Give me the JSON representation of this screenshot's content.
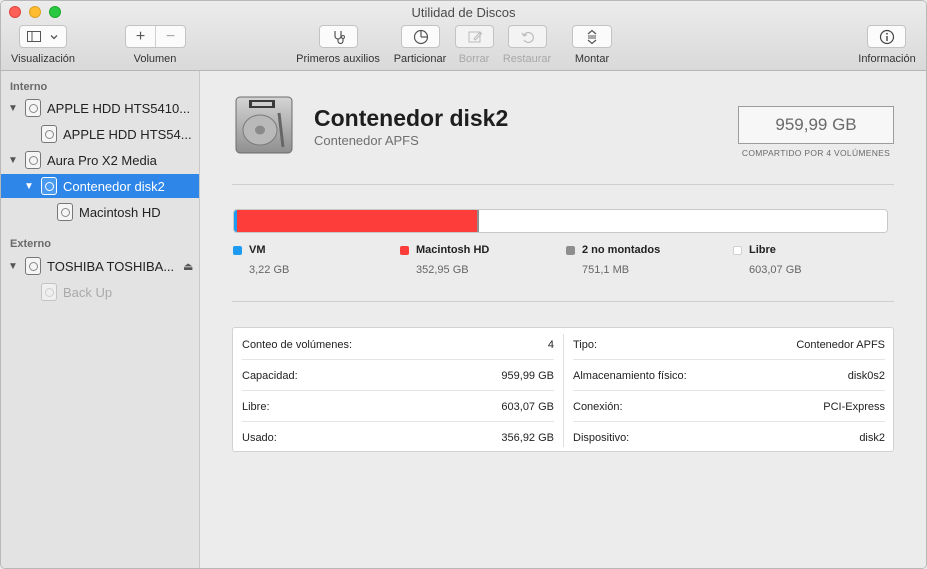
{
  "window": {
    "title": "Utilidad de Discos"
  },
  "toolbar": {
    "view_label": "Visualización",
    "volume_label": "Volumen",
    "first_aid_label": "Primeros auxilios",
    "partition_label": "Particionar",
    "erase_label": "Borrar",
    "restore_label": "Restaurar",
    "mount_label": "Montar",
    "info_label": "Información",
    "add_glyph": "+",
    "remove_glyph": "−"
  },
  "sidebar": {
    "internal_header": "Interno",
    "external_header": "Externo",
    "items": [
      {
        "label": "APPLE HDD HTS5410...",
        "level": 0
      },
      {
        "label": "APPLE HDD HTS54...",
        "level": 1
      },
      {
        "label": "Aura Pro X2 Media",
        "level": 0
      },
      {
        "label": "Contenedor disk2",
        "level": 1,
        "selected": true
      },
      {
        "label": "Macintosh HD",
        "level": 2
      },
      {
        "label": "TOSHIBA TOSHIBA...",
        "level": 0
      },
      {
        "label": "Back Up",
        "level": 1,
        "dim": true
      }
    ]
  },
  "volume": {
    "title": "Contenedor disk2",
    "subtitle": "Contenedor APFS",
    "capacity": "959,99 GB",
    "shared_note": "COMPARTIDO POR 4 VOLÚMENES"
  },
  "usage": {
    "total_gb": 959.99,
    "segments": [
      {
        "name": "VM",
        "value": "3,22 GB",
        "gb": 3.22,
        "color": "#1d9bf0"
      },
      {
        "name": "Macintosh HD",
        "value": "352,95 GB",
        "gb": 352.95,
        "color": "#fc3d39"
      },
      {
        "name": "2 no montados",
        "value": "751,1 MB",
        "gb": 0.75,
        "color": "#8e8e8e"
      },
      {
        "name": "Libre",
        "value": "603,07 GB",
        "gb": 603.07,
        "color": "#ffffff"
      }
    ]
  },
  "info": {
    "left": [
      {
        "label": "Conteo de volúmenes:",
        "value": "4"
      },
      {
        "label": "Capacidad:",
        "value": "959,99 GB"
      },
      {
        "label": "Libre:",
        "value": "603,07 GB"
      },
      {
        "label": "Usado:",
        "value": "356,92 GB"
      }
    ],
    "right": [
      {
        "label": "Tipo:",
        "value": "Contenedor APFS"
      },
      {
        "label": "Almacenamiento físico:",
        "value": "disk0s2"
      },
      {
        "label": "Conexión:",
        "value": "PCI-Express"
      },
      {
        "label": "Dispositivo:",
        "value": "disk2"
      }
    ]
  }
}
